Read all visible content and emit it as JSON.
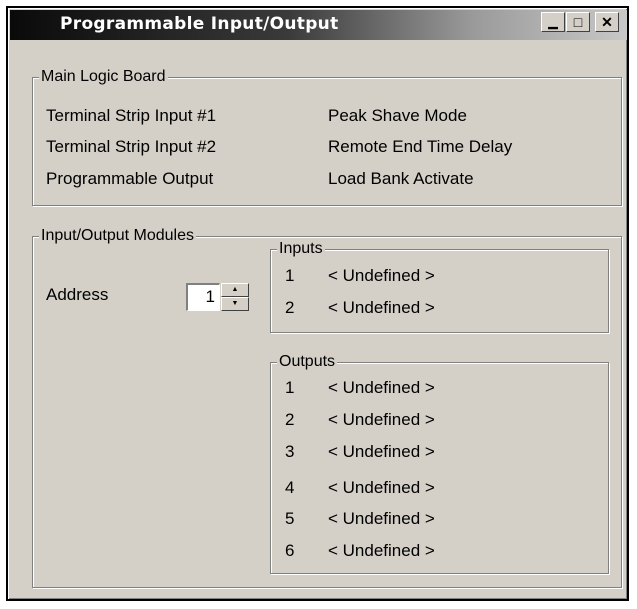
{
  "window": {
    "title": "Programmable Input/Output",
    "controls": {
      "minimize": "▁",
      "maximize": "□",
      "close": "✕"
    }
  },
  "main_logic_board": {
    "legend": "Main Logic Board",
    "items": [
      "Terminal Strip Input #1",
      "Peak Shave Mode",
      "Terminal Strip Input #2",
      "Remote End Time Delay",
      "Programmable Output",
      "Load Bank Activate"
    ]
  },
  "io_modules": {
    "legend": "Input/Output Modules",
    "address_label": "Address",
    "address_value": "1",
    "spin_up": "▲",
    "spin_down": "▼",
    "inputs": {
      "legend": "Inputs",
      "rows": [
        {
          "num": "1",
          "value": "< Undefined >"
        },
        {
          "num": "2",
          "value": "< Undefined >"
        }
      ]
    },
    "outputs": {
      "legend": "Outputs",
      "rows": [
        {
          "num": "1",
          "value": "< Undefined >"
        },
        {
          "num": "2",
          "value": "< Undefined >"
        },
        {
          "num": "3",
          "value": "< Undefined >"
        },
        {
          "num": "4",
          "value": "< Undefined >"
        },
        {
          "num": "5",
          "value": "< Undefined >"
        },
        {
          "num": "6",
          "value": "< Undefined >"
        }
      ]
    }
  }
}
